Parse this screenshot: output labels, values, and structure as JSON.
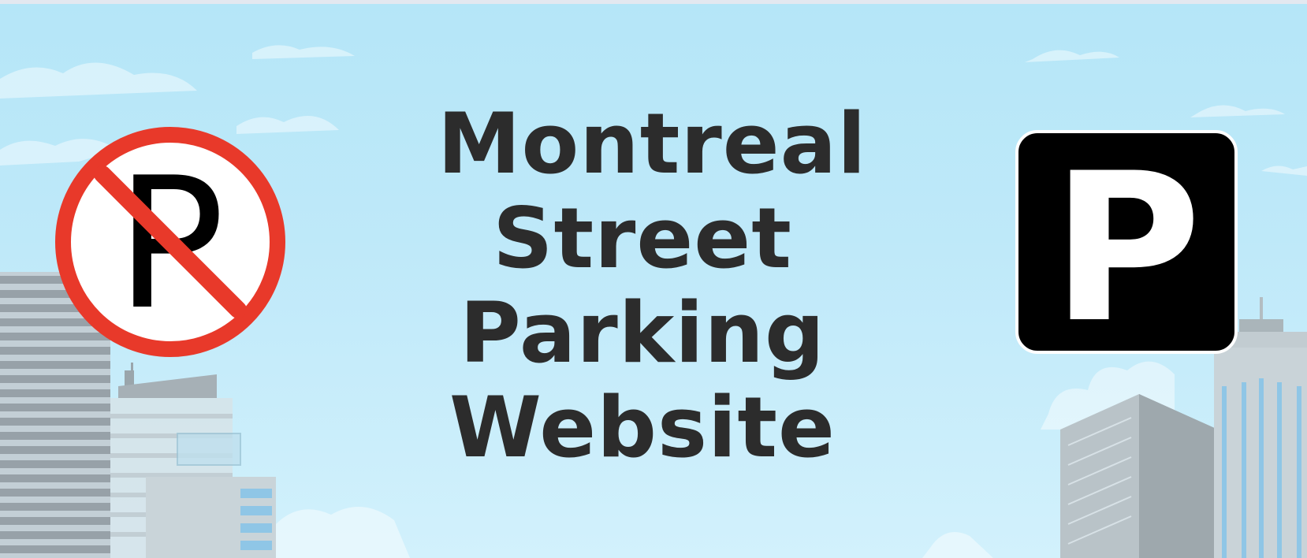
{
  "hero": {
    "title_lines": [
      "Montreal",
      "Street",
      "Parking",
      "Website"
    ],
    "parking_letter": "P",
    "colors": {
      "sky_top": "#b5e6f8",
      "sky_bottom": "#d2f1fc",
      "title_text": "#2c2c2c",
      "no_parking_red": "#e8392a",
      "parking_sign_bg": "#000000"
    },
    "icons": {
      "left": "no-parking-icon",
      "right": "parking-icon"
    }
  }
}
